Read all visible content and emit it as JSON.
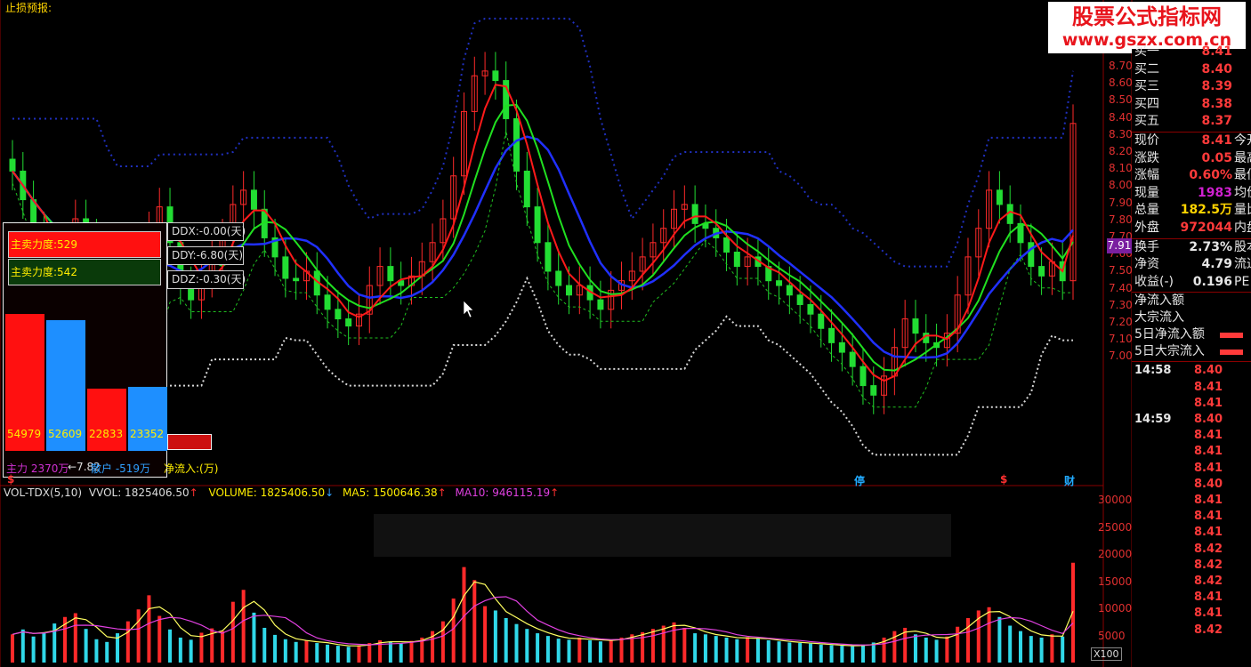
{
  "header": {
    "title": "止损预报:"
  },
  "watermark": {
    "line1": "股票公式指标网",
    "line2": "www.gszx.com.cn"
  },
  "price_axis": [
    "8.70",
    "8.60",
    "8.50",
    "8.40",
    "8.30",
    "8.20",
    "8.10",
    "8.00",
    "7.90",
    "7.80",
    "7.70",
    "7.60",
    "7.50",
    "7.40",
    "7.30",
    "7.20",
    "7.10",
    "7.00"
  ],
  "current_price_marker": "7.91",
  "volume_axis": [
    "30000",
    "25000",
    "20000",
    "15000",
    "10000",
    "5000"
  ],
  "volume_unit": "X100",
  "overlay": {
    "force1": "主卖力度:529",
    "force2": "主卖力度:542",
    "ddx": "DDX:-0.00(天)",
    "ddy": "DDY:-6.80(天)",
    "ddz": "DDZ:-0.30(天)",
    "bars": [
      {
        "value": "54979",
        "color": "#ff1010"
      },
      {
        "value": "52609",
        "color": "#1e8fff"
      },
      {
        "value": "22833",
        "color": "#ff1010"
      },
      {
        "value": "23352",
        "color": "#1e8fff"
      }
    ],
    "flow_main": "主力 2370万",
    "flow_arrow": "←7.82",
    "flow_retail": "散户 -519万",
    "flow_net": "净流入:(万)"
  },
  "signals": [
    {
      "text": "停",
      "color": "#22aaff"
    },
    {
      "text": "$",
      "color": "#ff3030"
    },
    {
      "text": "财",
      "color": "#22aaff"
    },
    {
      "text": "$",
      "color": "#ff3030"
    }
  ],
  "volume_header": {
    "name": "VOL-TDX(5,10)",
    "vvol": "VVOL: 1825406.50",
    "volume": "VOLUME: 1825406.50",
    "ma5": "MA5: 1500646.38",
    "ma10": "MA10: 946115.19"
  },
  "quote_panel": {
    "bids": [
      {
        "label": "买一",
        "value": "8.41"
      },
      {
        "label": "买二",
        "value": "8.40"
      },
      {
        "label": "买三",
        "value": "8.39"
      },
      {
        "label": "买四",
        "value": "8.38"
      },
      {
        "label": "买五",
        "value": "8.37"
      }
    ],
    "stats": [
      {
        "label": "现价",
        "value": "8.41",
        "ext": "今开",
        "color": "#ff3a3a"
      },
      {
        "label": "涨跌",
        "value": "0.05",
        "ext": "最高",
        "color": "#ff3a3a"
      },
      {
        "label": "涨幅",
        "value": "0.60%",
        "ext": "最低",
        "color": "#ff3a3a"
      },
      {
        "label": "现量",
        "value": "1983",
        "ext": "均价",
        "color": "#d020d0"
      },
      {
        "label": "总量",
        "value": "182.5万",
        "ext": "量比",
        "color": "#ffd400"
      },
      {
        "label": "外盘",
        "value": "972044",
        "ext": "内盘",
        "color": "#ff3a3a"
      }
    ],
    "stats2": [
      {
        "label": "换手",
        "value": "2.73%",
        "ext": "股本",
        "color": "#e6e6e6"
      },
      {
        "label": "净资",
        "value": "4.79",
        "ext": "流通",
        "color": "#e6e6e6"
      },
      {
        "label": "收益(-)",
        "value": "0.196",
        "ext": "PE",
        "color": "#e6e6e6"
      }
    ],
    "flows": [
      "净流入额",
      "大宗流入",
      "5日净流入额",
      "5日大宗流入"
    ],
    "ticks": [
      {
        "time": "14:58",
        "price": "8.40"
      },
      {
        "time": "",
        "price": "8.41"
      },
      {
        "time": "",
        "price": "8.41"
      },
      {
        "time": "14:59",
        "price": "8.40"
      },
      {
        "time": "",
        "price": "8.41"
      },
      {
        "time": "",
        "price": "8.41"
      },
      {
        "time": "",
        "price": "8.41"
      },
      {
        "time": "",
        "price": "8.40"
      },
      {
        "time": "",
        "price": "8.41"
      },
      {
        "time": "",
        "price": "8.41"
      },
      {
        "time": "",
        "price": "8.41"
      },
      {
        "time": "",
        "price": "8.42"
      },
      {
        "time": "",
        "price": "8.42"
      },
      {
        "time": "",
        "price": "8.42"
      },
      {
        "time": "",
        "price": "8.41"
      },
      {
        "time": "",
        "price": "8.41"
      },
      {
        "time": "",
        "price": "8.42"
      }
    ]
  },
  "chart_data": {
    "type": "candlestick",
    "price_range": [
      7.0,
      8.75
    ],
    "volume_range": [
      0,
      30000
    ],
    "closes": [
      8.2,
      8.08,
      7.95,
      7.85,
      7.78,
      7.88,
      8.0,
      7.92,
      7.74,
      7.6,
      7.55,
      7.7,
      7.82,
      7.95,
      8.05,
      7.9,
      7.72,
      7.66,
      7.75,
      7.86,
      7.92,
      8.06,
      8.12,
      8.04,
      7.92,
      7.84,
      7.75,
      7.74,
      7.78,
      7.68,
      7.62,
      7.58,
      7.55,
      7.6,
      7.72,
      7.8,
      7.74,
      7.72,
      7.76,
      7.82,
      7.9,
      8.0,
      8.18,
      8.45,
      8.6,
      8.62,
      8.58,
      8.42,
      8.2,
      8.05,
      7.9,
      7.78,
      7.72,
      7.68,
      7.72,
      7.66,
      7.62,
      7.7,
      7.74,
      7.78,
      7.84,
      7.9,
      7.96,
      8.04,
      8.06,
      7.98,
      7.96,
      7.92,
      7.86,
      7.8,
      7.84,
      7.8,
      7.74,
      7.72,
      7.68,
      7.64,
      7.6,
      7.54,
      7.48,
      7.44,
      7.38,
      7.3,
      7.26,
      7.34,
      7.46,
      7.58,
      7.52,
      7.48,
      7.46,
      7.52,
      7.68,
      7.84,
      7.96,
      8.12,
      8.06,
      7.98,
      7.9,
      7.8,
      7.76,
      7.82,
      7.74,
      8.4
    ],
    "volumes": [
      5200,
      6100,
      4800,
      5600,
      7200,
      8400,
      9100,
      6200,
      4300,
      3800,
      5400,
      7600,
      9800,
      12400,
      8600,
      6100,
      4600,
      4200,
      5500,
      6300,
      5800,
      11200,
      13400,
      9200,
      6400,
      5100,
      4300,
      3800,
      4100,
      3600,
      3300,
      3100,
      2900,
      3200,
      3600,
      4100,
      3800,
      3600,
      4000,
      4600,
      5800,
      7600,
      11800,
      17600,
      15200,
      10400,
      9600,
      8200,
      7100,
      6200,
      5400,
      4900,
      4400,
      4200,
      4600,
      4100,
      3900,
      4200,
      4600,
      5200,
      5600,
      6200,
      6800,
      7400,
      6400,
      5400,
      5200,
      4900,
      4600,
      4300,
      4700,
      4400,
      4100,
      3900,
      3700,
      3600,
      3500,
      3300,
      3200,
      3100,
      3000,
      3300,
      3700,
      4600,
      5800,
      6400,
      5200,
      4600,
      4200,
      4800,
      6600,
      8200,
      9600,
      10200,
      8400,
      6800,
      5800,
      4900,
      4600,
      5200,
      4800,
      18400
    ]
  }
}
